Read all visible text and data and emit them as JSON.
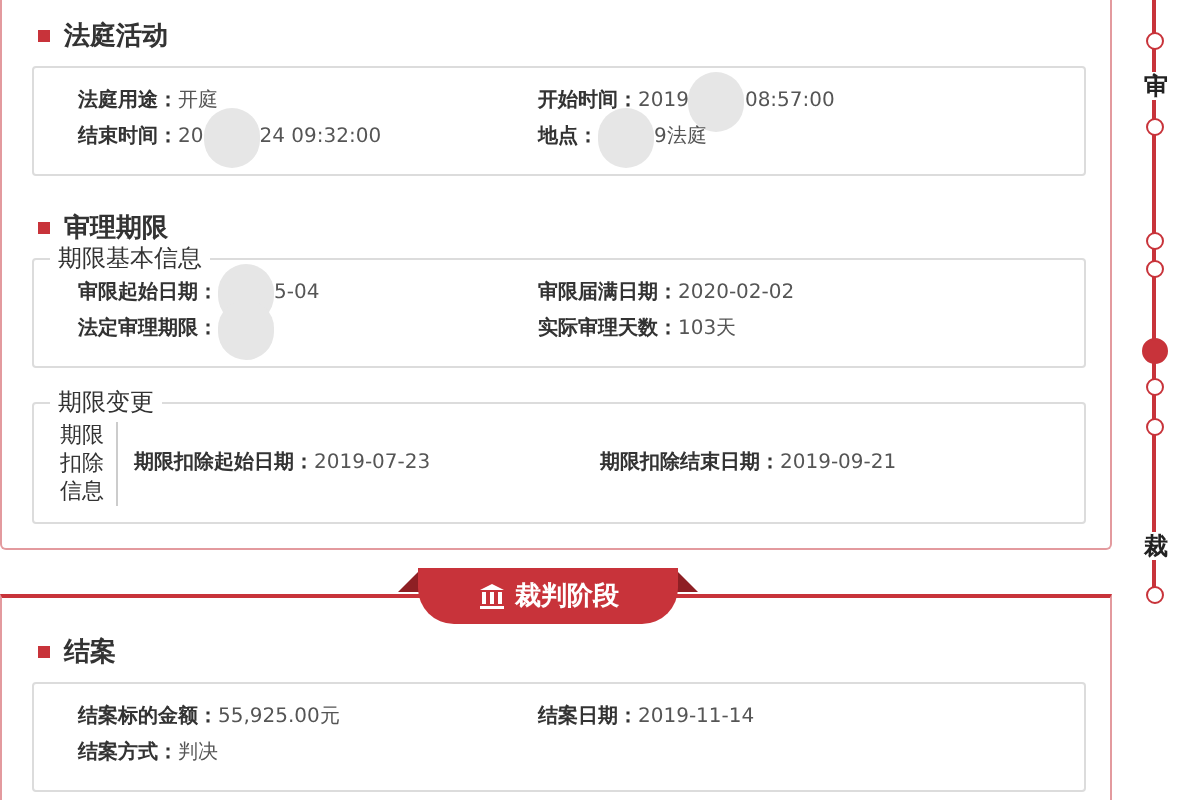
{
  "cards": [
    {
      "sections": [
        {
          "title": "法庭活动",
          "boxes": [
            {
              "kind": "plain",
              "rows": [
                [
                  {
                    "label": "法庭用途：",
                    "parts": [
                      {
                        "kind": "text",
                        "text": "开庭"
                      }
                    ]
                  },
                  {
                    "label": "开始时间：",
                    "parts": [
                      {
                        "kind": "text",
                        "text": "2019"
                      },
                      {
                        "kind": "blur"
                      },
                      {
                        "kind": "text",
                        "text": "08:57:00"
                      }
                    ]
                  }
                ],
                [
                  {
                    "label": "结束时间：",
                    "parts": [
                      {
                        "kind": "text",
                        "text": "20"
                      },
                      {
                        "kind": "blur"
                      },
                      {
                        "kind": "text",
                        "text": "24 09:32:00"
                      }
                    ]
                  },
                  {
                    "label": "地点：",
                    "parts": [
                      {
                        "kind": "blur"
                      },
                      {
                        "kind": "text",
                        "text": "9法庭"
                      }
                    ]
                  }
                ]
              ]
            }
          ]
        },
        {
          "title": "审理期限",
          "boxes": [
            {
              "kind": "legend",
              "legend": "期限基本信息",
              "rows": [
                [
                  {
                    "label": "审限起始日期：",
                    "parts": [
                      {
                        "kind": "blur"
                      },
                      {
                        "kind": "text",
                        "text": "5-04"
                      }
                    ]
                  },
                  {
                    "label": "审限届满日期：",
                    "parts": [
                      {
                        "kind": "text",
                        "text": "2020-02-02"
                      }
                    ]
                  }
                ],
                [
                  {
                    "label": "法定审理期限：",
                    "parts": [
                      {
                        "kind": "blur"
                      }
                    ]
                  },
                  {
                    "label": "实际审理天数：",
                    "parts": [
                      {
                        "kind": "text",
                        "text": "103天"
                      }
                    ]
                  }
                ]
              ]
            },
            {
              "kind": "sidelabel",
              "legend": "期限变更",
              "side": "期限扣除信息",
              "rows": [
                [
                  {
                    "label": "期限扣除起始日期：",
                    "parts": [
                      {
                        "kind": "text",
                        "text": "2019-07-23"
                      }
                    ]
                  },
                  {
                    "label": "期限扣除结束日期：",
                    "parts": [
                      {
                        "kind": "text",
                        "text": "2019-09-21"
                      }
                    ]
                  }
                ]
              ]
            }
          ]
        }
      ]
    },
    {
      "banner": "裁判阶段",
      "sections": [
        {
          "title": "结案",
          "boxes": [
            {
              "kind": "plain",
              "rows": [
                [
                  {
                    "label": "结案标的金额：",
                    "parts": [
                      {
                        "kind": "text",
                        "text": "55,925.00元"
                      }
                    ]
                  },
                  {
                    "label": "结案日期：",
                    "parts": [
                      {
                        "kind": "text",
                        "text": "2019-11-14"
                      }
                    ]
                  }
                ],
                [
                  {
                    "label": "结案方式：",
                    "parts": [
                      {
                        "kind": "text",
                        "text": "判决"
                      }
                    ]
                  }
                ]
              ]
            }
          ]
        }
      ]
    }
  ],
  "timeline": [
    {
      "kind": "dot",
      "current": false
    },
    {
      "kind": "label",
      "text": "审"
    },
    {
      "kind": "dot",
      "current": false
    },
    {
      "kind": "dot",
      "current": false
    },
    {
      "kind": "dot",
      "current": false
    },
    {
      "kind": "dot",
      "current": true
    },
    {
      "kind": "dot",
      "current": false
    },
    {
      "kind": "dot",
      "current": false
    },
    {
      "kind": "label",
      "text": "裁"
    },
    {
      "kind": "dot",
      "current": false
    }
  ]
}
